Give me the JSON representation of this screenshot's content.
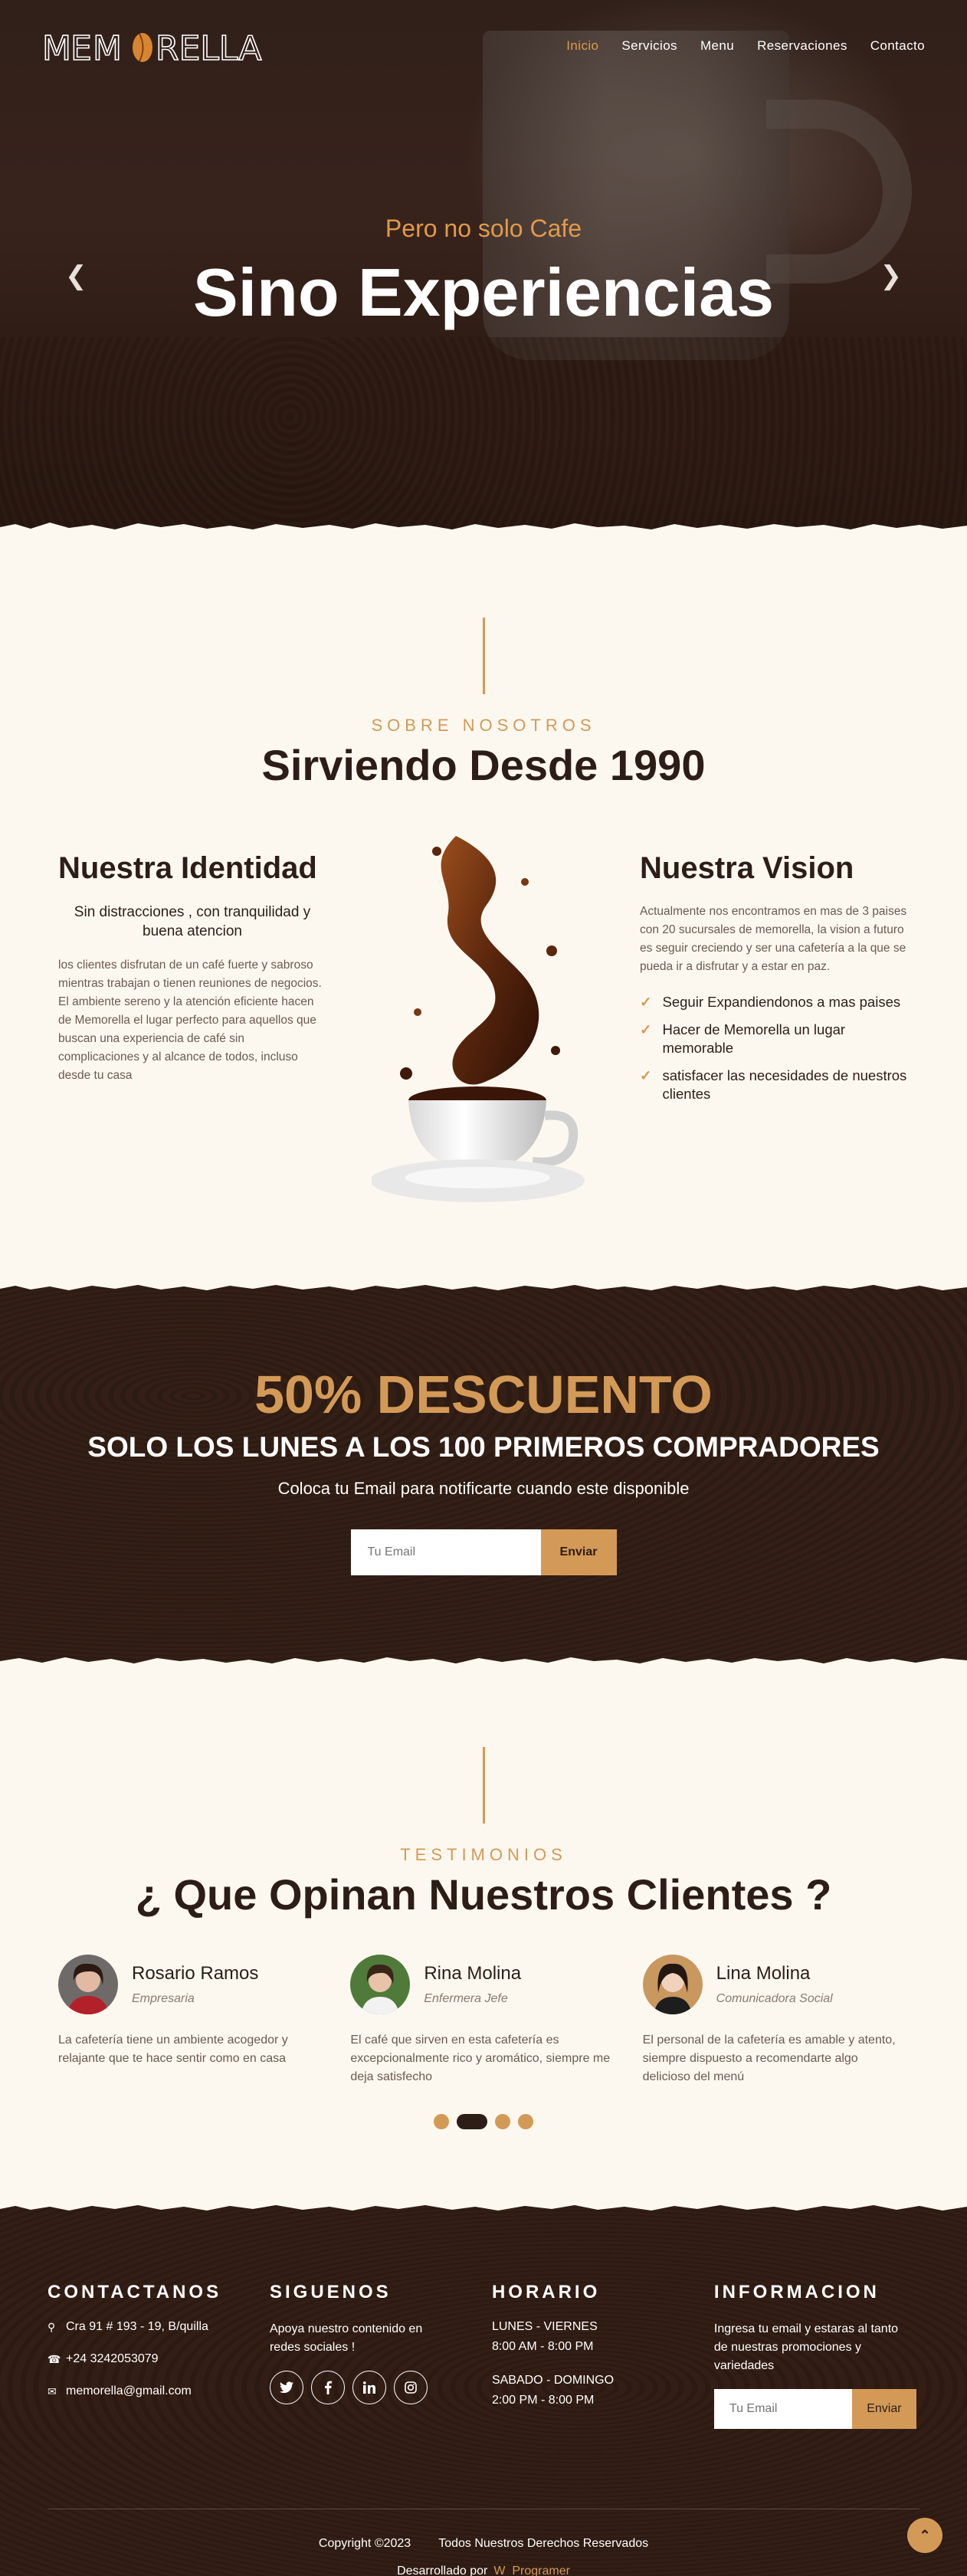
{
  "nav": {
    "logo_text": "MEMORELLA",
    "items": [
      {
        "label": "Inicio",
        "active": true
      },
      {
        "label": "Servicios",
        "active": false
      },
      {
        "label": "Menu",
        "active": false
      },
      {
        "label": "Reservaciones",
        "active": false
      },
      {
        "label": "Contacto",
        "active": false
      }
    ]
  },
  "hero": {
    "subtitle": "Pero no solo Cafe",
    "title": "Sino Experiencias",
    "prev_icon": "chevron-left-icon",
    "next_icon": "chevron-right-icon"
  },
  "about": {
    "kicker": "SOBRE NOSOTROS",
    "title": "Sirviendo Desde 1990",
    "identity": {
      "heading": "Nuestra Identidad",
      "lead": "Sin distracciones , con tranquilidad y buena atencion",
      "body": "los clientes disfrutan de un café fuerte y sabroso mientras trabajan o tienen reuniones de negocios. El ambiente sereno y la atención eficiente hacen de Memorella el lugar perfecto para aquellos que buscan una experiencia de café sin complicaciones y al alcance de todos, incluso desde tu casa"
    },
    "vision": {
      "heading": "Nuestra Vision",
      "body": "Actualmente nos encontramos en mas de 3 paises con 20 sucursales de memorella, la vision a futuro es seguir creciendo y ser una cafetería a la que se pueda ir a disfrutar y a estar en paz.",
      "points": [
        "Seguir Expandiendonos a mas paises",
        "Hacer de Memorella un lugar memorable",
        "satisfacer las necesidades de nuestros clientes"
      ]
    }
  },
  "promo": {
    "headline": "50% DESCUENTO",
    "subheadline": "SOLO LOS LUNES A LOS 100 PRIMEROS COMPRADORES",
    "text": "Coloca tu Email para notificarte cuando este disponible",
    "email_placeholder": "Tu Email",
    "button": "Enviar"
  },
  "testimonials": {
    "kicker": "TESTIMONIOS",
    "title": "¿ Que Opinan Nuestros Clientes ?",
    "items": [
      {
        "name": "Rosario Ramos",
        "role": "Empresaria",
        "text": "La cafetería tiene un ambiente acogedor y relajante que te hace sentir como en casa"
      },
      {
        "name": "Rina Molina",
        "role": "Enfermera Jefe",
        "text": "El café que sirven en esta cafetería es excepcionalmente rico y aromático, siempre me deja satisfecho"
      },
      {
        "name": "Lina Molina",
        "role": "Comunicadora Social",
        "text": "El personal de la cafetería es amable y atento, siempre dispuesto a recomendarte algo delicioso del menú"
      }
    ],
    "active_dot": 1,
    "dot_count": 4
  },
  "footer": {
    "contact": {
      "heading": "CONTACTANOS",
      "address": "Cra 91 # 193 - 19, B/quilla",
      "phone": "+24 3242053079",
      "email": "memorella@gmail.com"
    },
    "follow": {
      "heading": "SIGUENOS",
      "text": "Apoya nuestro contenido en redes sociales !",
      "networks": [
        "twitter-icon",
        "facebook-icon",
        "linkedin-icon",
        "instagram-icon"
      ]
    },
    "schedule": {
      "heading": "HORARIO",
      "weekdays_label": "LUNES - VIERNES",
      "weekdays_hours": "8:00 AM - 8:00 PM",
      "weekend_label": "SABADO - DOMINGO",
      "weekend_hours": "2:00 PM - 8:00 PM"
    },
    "info": {
      "heading": "INFORMACION",
      "text": "Ingresa tu email y estaras al tanto de nuestras promociones y variedades",
      "email_placeholder": "Tu Email",
      "button": "Enviar"
    },
    "copyright": "Copyright ©2023",
    "rights": "Todos Nuestros Derechos Reservados",
    "dev_label": "Desarrollado por",
    "dev_name": "W_Programer"
  },
  "colors": {
    "accent": "#d39a57",
    "dark": "#2d1d17",
    "cream": "#fdf8ef"
  }
}
